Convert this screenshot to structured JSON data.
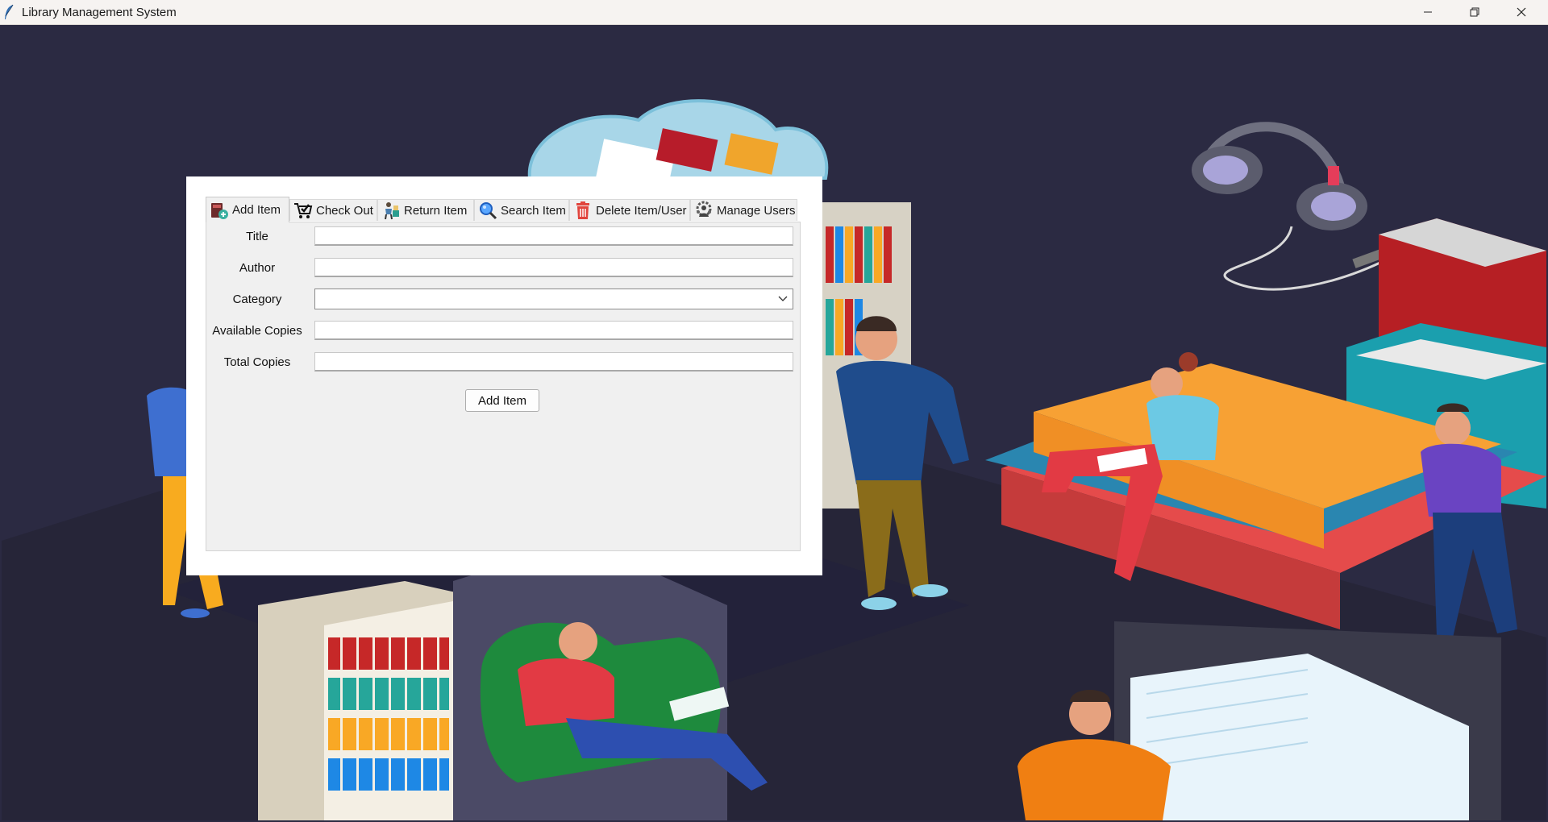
{
  "window": {
    "title": "Library Management System",
    "controls": {
      "minimize_icon": "minimize-icon",
      "maximize_icon": "restore-icon",
      "close_icon": "close-icon"
    }
  },
  "tabs": [
    {
      "label": "Add Item",
      "icon": "add-item-icon",
      "active": true
    },
    {
      "label": "Check Out",
      "icon": "cart-check-icon",
      "active": false
    },
    {
      "label": "Return Item",
      "icon": "return-person-icon",
      "active": false
    },
    {
      "label": "Search Item",
      "icon": "magnifier-icon",
      "active": false
    },
    {
      "label": "Delete Item/User",
      "icon": "trash-icon",
      "active": false
    },
    {
      "label": "Manage Users",
      "icon": "users-gear-icon",
      "active": false
    }
  ],
  "form": {
    "title_label": "Title",
    "title_value": "",
    "author_label": "Author",
    "author_value": "",
    "category_label": "Category",
    "category_value": "",
    "available_label": "Available Copies",
    "available_value": "",
    "total_label": "Total Copies",
    "total_value": "",
    "submit_label": "Add Item"
  },
  "colors": {
    "background": "#2b2a42",
    "panel": "#ffffff",
    "tab_body": "#f0f0f0",
    "accent_red": "#e1443c"
  }
}
